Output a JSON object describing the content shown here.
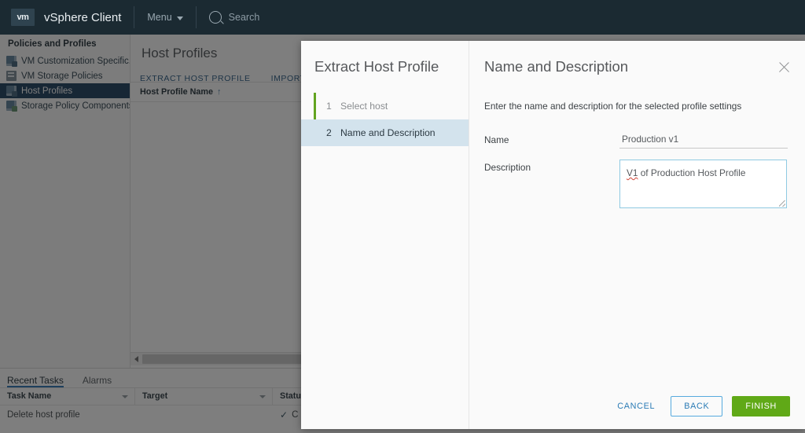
{
  "topbar": {
    "logo": "vm",
    "brand": "vSphere Client",
    "menu_label": "Menu",
    "search_placeholder": "Search"
  },
  "sidebar": {
    "heading": "Policies and Profiles",
    "items": [
      {
        "label": "VM Customization Specific...",
        "icon": "document-copy-icon",
        "active": false
      },
      {
        "label": "VM Storage Policies",
        "icon": "storage-policy-icon",
        "active": false
      },
      {
        "label": "Host Profiles",
        "icon": "host-profile-icon",
        "active": true
      },
      {
        "label": "Storage Policy Components",
        "icon": "policy-component-icon",
        "active": false
      }
    ]
  },
  "main": {
    "page_title": "Host Profiles",
    "toolbar": [
      {
        "label": "EXTRACT HOST PROFILE"
      },
      {
        "label": "IMPORT HOST P"
      }
    ],
    "table": {
      "columns": [
        "Host Profile Name"
      ],
      "sort_indicator": "↑",
      "rows": []
    }
  },
  "tasks": {
    "tabs": [
      {
        "label": "Recent Tasks",
        "active": true
      },
      {
        "label": "Alarms",
        "active": false
      }
    ],
    "columns": [
      "Task Name",
      "Target",
      "Status"
    ],
    "rows": [
      {
        "task_name": "Delete host profile",
        "target": "",
        "status": "C",
        "status_icon": "check-icon"
      }
    ]
  },
  "modal": {
    "wizard_title": "Extract Host Profile",
    "steps": [
      {
        "number": "1",
        "label": "Select host",
        "state": "done"
      },
      {
        "number": "2",
        "label": "Name and Description",
        "state": "current"
      }
    ],
    "panel_title": "Name and Description",
    "close_icon": "close-icon",
    "instruction": "Enter the name and description for the selected profile settings",
    "fields": {
      "name_label": "Name",
      "name_value": "Production v1",
      "name_placeholder": "",
      "description_label": "Description",
      "description_misspelled": "V1",
      "description_rest": " of Production Host Profile"
    },
    "buttons": {
      "cancel": "CANCEL",
      "back": "BACK",
      "finish": "FINISH"
    },
    "colors": {
      "finish_green": "#60a917",
      "step_done_green": "#62a420",
      "link_blue": "#2a7bb5",
      "focus_border": "#8fcae2"
    }
  }
}
